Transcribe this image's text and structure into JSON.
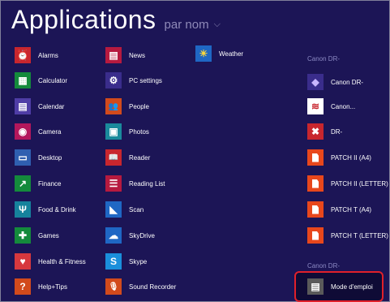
{
  "header": {
    "title": "Applications",
    "sort_label": "par nom",
    "sort_chevron": "⌵"
  },
  "col1": [
    {
      "label": "Alarms",
      "color": "#c8262e",
      "glyph": "⏰"
    },
    {
      "label": "Calculator",
      "color": "#148a3c",
      "glyph": "▦"
    },
    {
      "label": "Calendar",
      "color": "#4f3da6",
      "glyph": "▤"
    },
    {
      "label": "Camera",
      "color": "#b3175c",
      "glyph": "◉"
    },
    {
      "label": "Desktop",
      "color": "#2f5fb0",
      "glyph": "▭"
    },
    {
      "label": "Finance",
      "color": "#148a3c",
      "glyph": "↗"
    },
    {
      "label": "Food & Drink",
      "color": "#16829c",
      "glyph": "Ψ"
    },
    {
      "label": "Games",
      "color": "#148a3c",
      "glyph": "✚"
    },
    {
      "label": "Health & Fitness",
      "color": "#d7383e",
      "glyph": "♥"
    },
    {
      "label": "Help+Tips",
      "color": "#d24a1c",
      "glyph": "?"
    }
  ],
  "col2": [
    {
      "label": "News",
      "color": "#b61a3f",
      "glyph": "▤"
    },
    {
      "label": "PC settings",
      "color": "#3a2d8c",
      "glyph": "⚙"
    },
    {
      "label": "People",
      "color": "#d24a1c",
      "glyph": "👥"
    },
    {
      "label": "Photos",
      "color": "#1a8a9c",
      "glyph": "▣"
    },
    {
      "label": "Reader",
      "color": "#c8262e",
      "glyph": "📖"
    },
    {
      "label": "Reading List",
      "color": "#b61a3f",
      "glyph": "☰"
    },
    {
      "label": "Scan",
      "color": "#1f67c4",
      "glyph": "◣"
    },
    {
      "label": "SkyDrive",
      "color": "#1f67c4",
      "glyph": "☁"
    },
    {
      "label": "Skype",
      "color": "#1a8fdb",
      "glyph": "S"
    },
    {
      "label": "Sound Recorder",
      "color": "#d24a1c",
      "glyph": "🎙"
    }
  ],
  "col3": [
    {
      "label": "Weather",
      "color": "#1f67c4",
      "glyph": "☀"
    }
  ],
  "group1": {
    "header": "Canon DR-",
    "items": [
      {
        "label": "Canon DR-",
        "color": "#ffffff",
        "glyph": "◆"
      },
      {
        "label": "Canon...",
        "color": "#ffffff",
        "glyph": "≋"
      },
      {
        "label": "DR-",
        "color": "#c8262e",
        "glyph": "✖"
      },
      {
        "label": "PATCH II (A4)",
        "color": "#e8471c",
        "glyph": ""
      },
      {
        "label": "PATCH II (LETTER)",
        "color": "#e8471c",
        "glyph": ""
      },
      {
        "label": "PATCH T (A4)",
        "color": "#e8471c",
        "glyph": ""
      },
      {
        "label": "PATCH T (LETTER)",
        "color": "#e8471c",
        "glyph": ""
      }
    ]
  },
  "group2": {
    "header": "Canon DR-",
    "items": [
      {
        "label": "Mode d'emploi",
        "color": "#5a5a5a",
        "glyph": "▤"
      }
    ]
  }
}
